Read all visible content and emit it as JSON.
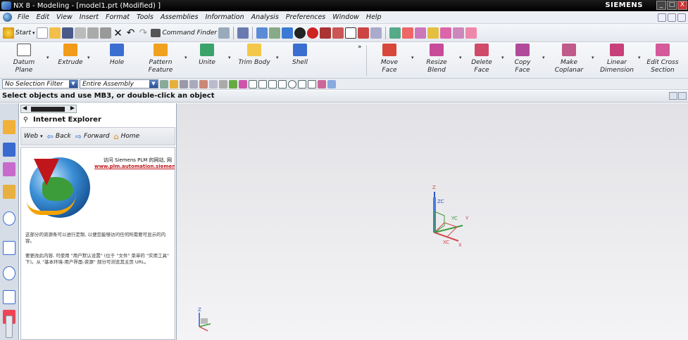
{
  "window": {
    "title": "NX 8 - Modeling - [model1.prt (Modified) ]",
    "brand": "SIEMENS",
    "minimize": "_",
    "restore": "□",
    "close": "X"
  },
  "menu": [
    "File",
    "Edit",
    "View",
    "Insert",
    "Format",
    "Tools",
    "Assemblies",
    "Information",
    "Analysis",
    "Preferences",
    "Window",
    "Help"
  ],
  "toolbar": {
    "start": "Start",
    "command_finder": "Command Finder"
  },
  "ribbon": {
    "left": [
      {
        "label": "Datum Plane",
        "line2": ""
      },
      {
        "label": "Extrude",
        "line2": ""
      },
      {
        "label": "Hole",
        "line2": ""
      },
      {
        "label": "Pattern",
        "line2": "Feature"
      },
      {
        "label": "Unite",
        "line2": ""
      },
      {
        "label": "Trim Body",
        "line2": ""
      },
      {
        "label": "Shell",
        "line2": ""
      }
    ],
    "right": [
      {
        "label": "Move Face",
        "line2": ""
      },
      {
        "label": "Resize Blend",
        "line2": ""
      },
      {
        "label": "Delete Face",
        "line2": ""
      },
      {
        "label": "Copy Face",
        "line2": ""
      },
      {
        "label": "Make",
        "line2": "Coplanar"
      },
      {
        "label": "Linear",
        "line2": "Dimension"
      },
      {
        "label": "Edit Cross",
        "line2": "Section"
      }
    ]
  },
  "filter": {
    "selection_filter": "No Selection Filter",
    "scope": "Entire Assembly"
  },
  "status": {
    "prompt": "Select objects and use MB3, or double-click an object"
  },
  "navigator": {
    "title": "Internet Explorer",
    "nav": {
      "web": "Web",
      "back": "Back",
      "forward": "Forward",
      "home": "Home"
    },
    "welcome_line1": "访问 Siemens PLM 的网站, 网",
    "welcome_link": "www.plm.automation.siemen",
    "para1": "这部分的资源条可以进行定制, 以便您能够访问任何所需要可显示的内容。",
    "para2": "要更改此内容, 可使用 \"用户默认设置\" (位于 \"文件\" 菜单的 \"实用工具\" 下)。从 \"基本环境-用户界面-资源\" 部分可浏览其主页 URL。"
  },
  "csys": {
    "z": "Z",
    "zc": "ZC",
    "yc": "YC",
    "y": "Y",
    "xc": "XC",
    "x": "X"
  },
  "mini_triad": {
    "z": "Z"
  }
}
